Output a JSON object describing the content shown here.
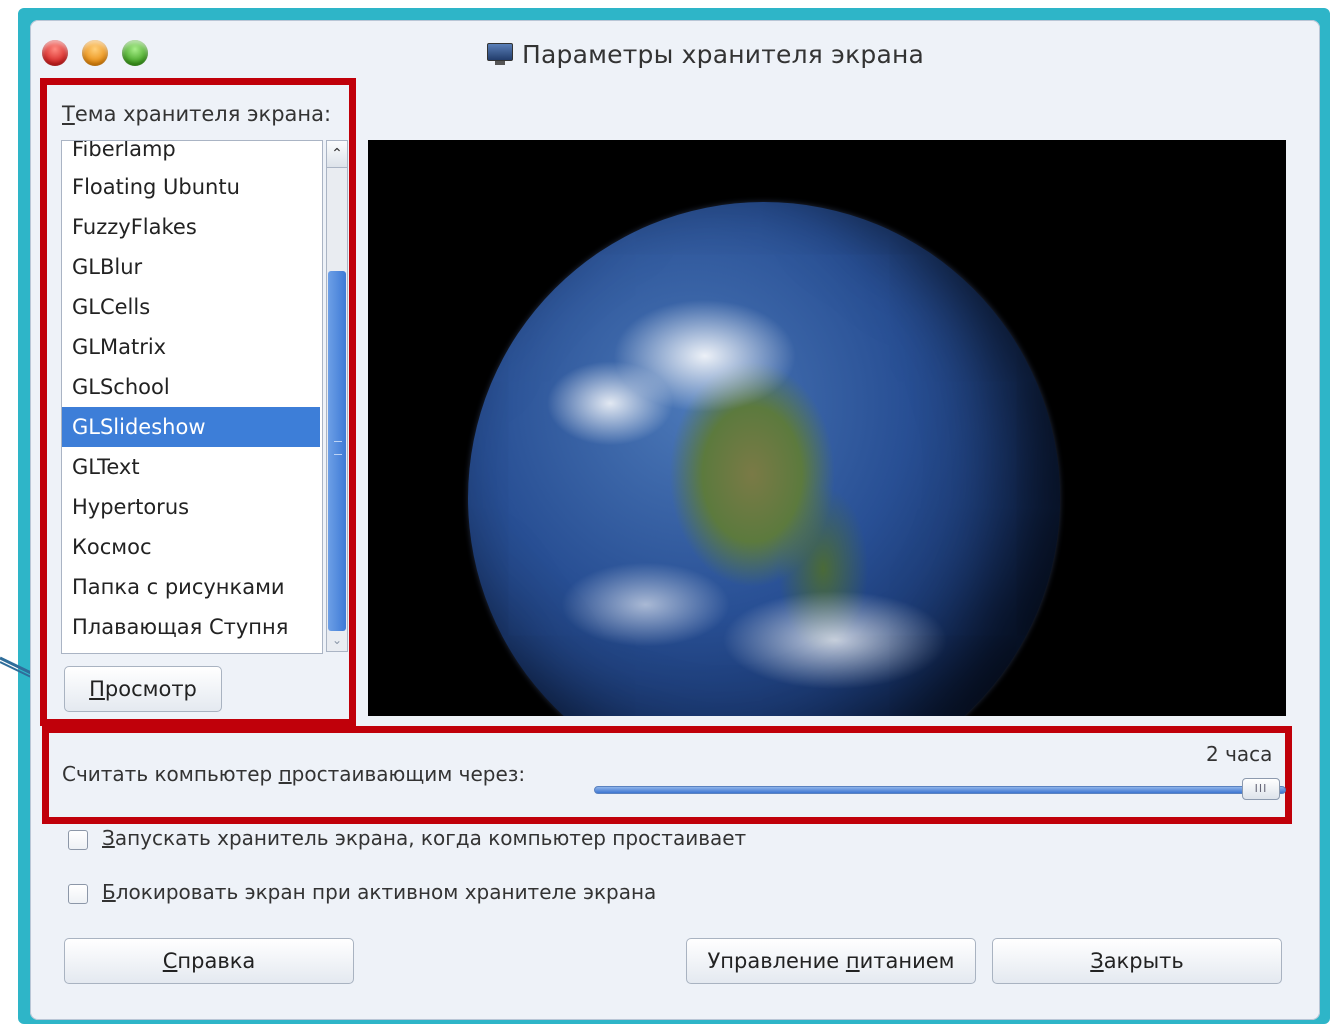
{
  "window": {
    "title": "Параметры хранителя экрана",
    "title_icon": "monitor-icon",
    "controls": [
      "close",
      "minimize",
      "maximize"
    ]
  },
  "theme": {
    "label_prefix": "Т",
    "label_rest": "ема хранителя экрана:",
    "items": [
      "Fiberlamp",
      "Floating Ubuntu",
      "FuzzyFlakes",
      "GLBlur",
      "GLCells",
      "GLMatrix",
      "GLSchool",
      "GLSlideshow",
      "GLText",
      "Hypertorus",
      "Космос",
      "Папка с рисунками",
      "Плавающая Ступня"
    ],
    "selected": "GLSlideshow"
  },
  "buttons": {
    "preview_accel": "П",
    "preview_rest": "росмотр",
    "help_accel": "С",
    "help_rest": "правка",
    "power_before": "Управление ",
    "power_accel": "п",
    "power_rest": "итанием",
    "close_accel": "З",
    "close_rest": "акрыть"
  },
  "idle": {
    "label_before": "Считать компьютер ",
    "label_accel": "п",
    "label_rest": "ростаивающим через:",
    "value": "2 часа",
    "slider_fraction": 1.0
  },
  "options": {
    "activate_accel": "З",
    "activate_rest": "апускать хранитель экрана, когда компьютер простаивает",
    "activate_checked": false,
    "lock_accel": "Б",
    "lock_rest": "локировать экран при активном хранителе экрана",
    "lock_checked": false
  },
  "colors": {
    "selection": "#3d7ed8",
    "highlight_frame": "#c0000a",
    "outer_frame": "#2eb5c8"
  }
}
